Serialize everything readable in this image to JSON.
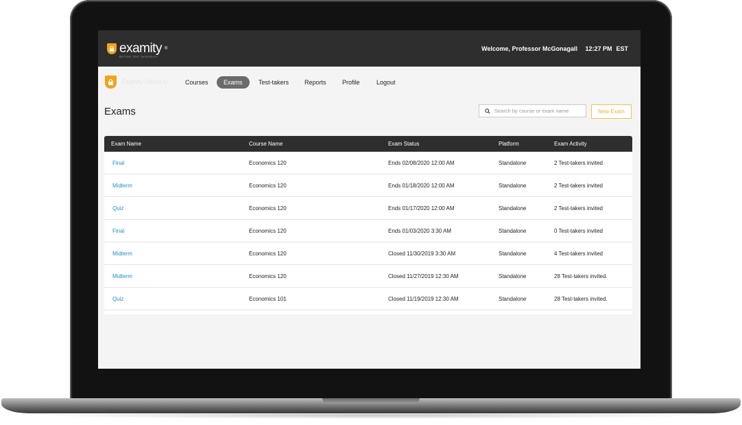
{
  "header": {
    "logo_text": "examity",
    "logo_tm": "®",
    "logo_tagline": "BETTER TEST INTEGRITY",
    "welcome": "Welcome, Professor McGonagall",
    "time": "12:27 PM",
    "timezone": "EST"
  },
  "nav": {
    "brand": "Examity Demo U",
    "items": [
      "Courses",
      "Exams",
      "Test-takers",
      "Reports",
      "Profile",
      "Logout"
    ],
    "active": "Exams"
  },
  "page": {
    "title": "Exams",
    "search_placeholder": "Search by course or exam name",
    "new_button": "New Exam"
  },
  "table": {
    "columns": [
      "Exam Name",
      "Course Name",
      "Exam Status",
      "Platform",
      "Exam Activity"
    ],
    "rows": [
      {
        "exam": "Final",
        "course": "Economics 120",
        "status": "Ends 02/08/2020 12:00 AM",
        "platform": "Standalone",
        "activity": "2 Test-takers invited"
      },
      {
        "exam": "Midterm",
        "course": "Economics 120",
        "status": "Ends 01/18/2020 12:00 AM",
        "platform": "Standalone",
        "activity": "2 Test-takers invited"
      },
      {
        "exam": "Quiz",
        "course": "Economics 120",
        "status": "Ends 01/17/2020 12:00 AM",
        "platform": "Standalone",
        "activity": "2 Test-takers invited"
      },
      {
        "exam": "Final",
        "course": "Economics 120",
        "status": "Ends 01/03/2020 3:30 AM",
        "platform": "Standalone",
        "activity": "0 Test-takers invited"
      },
      {
        "exam": "Midterm",
        "course": "Economics 120",
        "status": "Closed 11/30/2019 3:30 AM",
        "platform": "Standalone",
        "activity": "4 Test-takers invited"
      },
      {
        "exam": "Midterm",
        "course": "Economics 120",
        "status": "Closed 11/27/2019 12:30 AM",
        "platform": "Standalone",
        "activity": "28 Test-takers invited."
      },
      {
        "exam": "Quiz",
        "course": "Economics 101",
        "status": "Closed 11/19/2019 12:30 AM",
        "platform": "Standalone",
        "activity": "28 Test-takers invited."
      }
    ]
  },
  "colors": {
    "header_bg": "#2e2e2e",
    "accent": "#f2a31b",
    "link": "#1f8fc4",
    "active_tab": "#6b6b6b"
  },
  "icons": {
    "logo": "lock-shield-icon",
    "search": "search-icon"
  }
}
